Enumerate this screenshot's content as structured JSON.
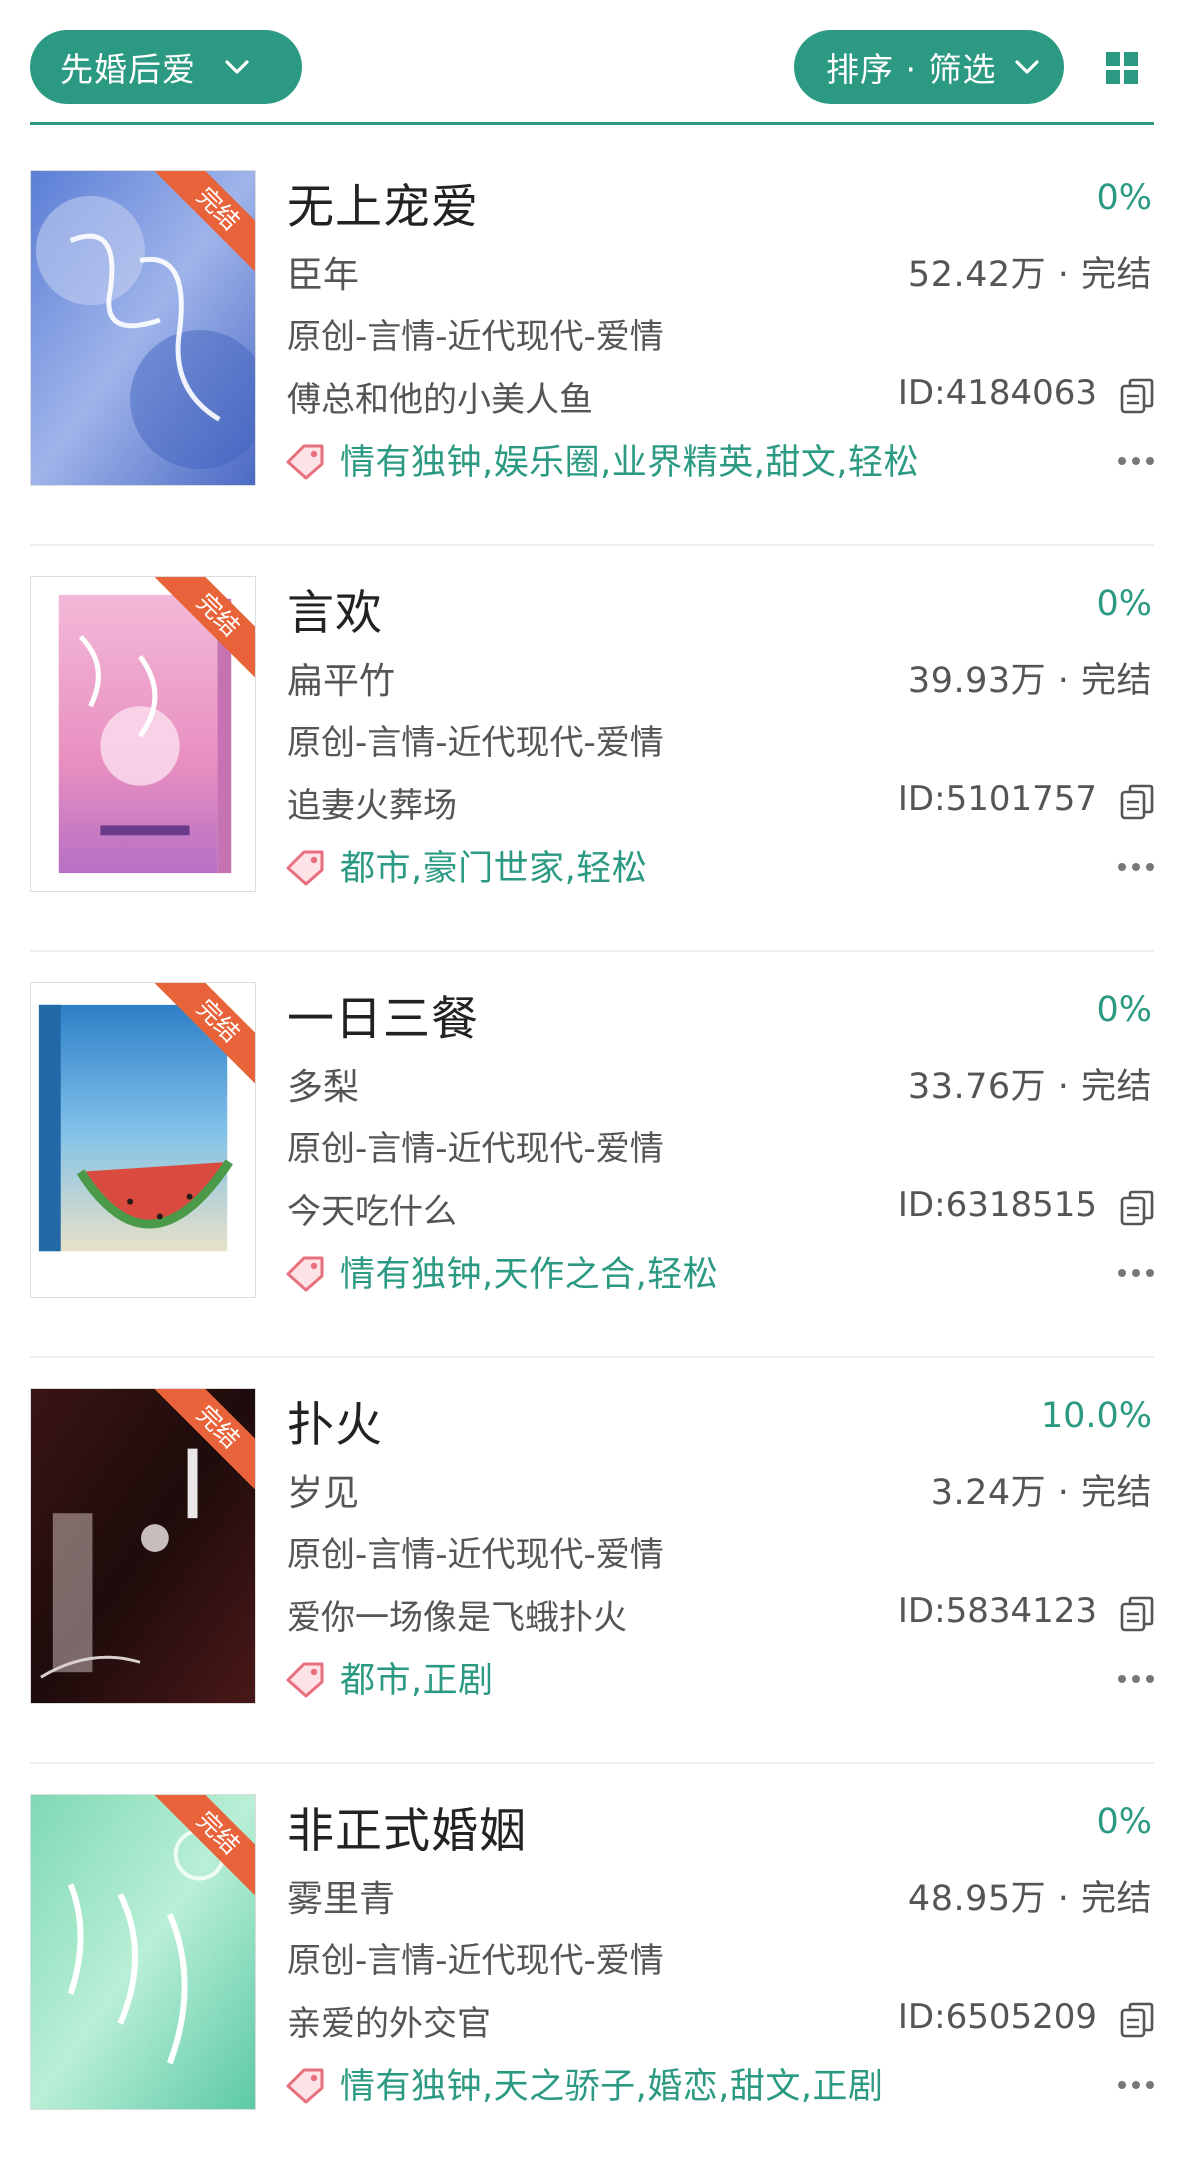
{
  "header": {
    "category_label": "先婚后爱",
    "sort_filter_label": "排序 · 筛选"
  },
  "colors": {
    "accent": "#2c9a83",
    "ribbon": "#e8633a",
    "tag_icon": "#e86f7e"
  },
  "icons": {
    "dropdown": "chevron-down-icon",
    "view_toggle": "grid-icon",
    "copy": "copy-icon",
    "tag": "tag-icon",
    "more": "more-icon"
  },
  "books": [
    {
      "title": "无上宠爱",
      "progress": "0%",
      "author": "臣年",
      "stats": "52.42万 · 完结",
      "category": "原创-言情-近代现代-爱情",
      "description": "傅总和他的小美人鱼",
      "book_id": "ID:4184063",
      "tags": "情有独钟,娱乐圈,业界精英,甜文,轻松",
      "ribbon": "完结"
    },
    {
      "title": "言欢",
      "progress": "0%",
      "author": "扁平竹",
      "stats": "39.93万 · 完结",
      "category": "原创-言情-近代现代-爱情",
      "description": "追妻火葬场",
      "book_id": "ID:5101757",
      "tags": "都市,豪门世家,轻松",
      "ribbon": "完结"
    },
    {
      "title": "一日三餐",
      "progress": "0%",
      "author": "多梨",
      "stats": "33.76万 · 完结",
      "category": "原创-言情-近代现代-爱情",
      "description": "今天吃什么",
      "book_id": "ID:6318515",
      "tags": "情有独钟,天作之合,轻松",
      "ribbon": "完结"
    },
    {
      "title": "扑火",
      "progress": "10.0%",
      "author": "岁见",
      "stats": "3.24万 · 完结",
      "category": "原创-言情-近代现代-爱情",
      "description": "爱你一场像是飞蛾扑火",
      "book_id": "ID:5834123",
      "tags": "都市,正剧",
      "ribbon": "完结"
    },
    {
      "title": "非正式婚姻",
      "progress": "0%",
      "author": "雾里青",
      "stats": "48.95万 · 完结",
      "category": "原创-言情-近代现代-爱情",
      "description": "亲爱的外交官",
      "book_id": "ID:6505209",
      "tags": "情有独钟,天之骄子,婚恋,甜文,正剧",
      "ribbon": "完结"
    }
  ]
}
